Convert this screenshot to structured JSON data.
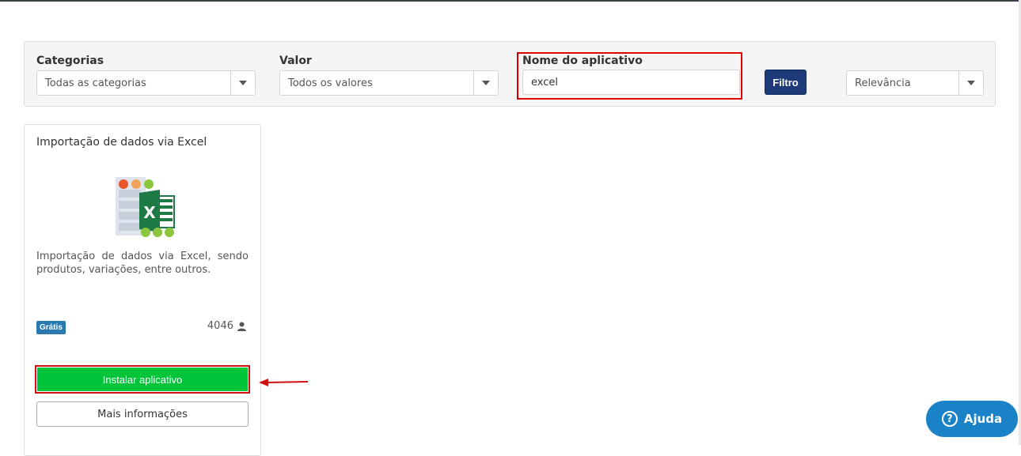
{
  "filters": {
    "categories": {
      "label": "Categorias",
      "value": "Todas as categorias"
    },
    "value": {
      "label": "Valor",
      "value": "Todos os valores"
    },
    "app_name": {
      "label": "Nome do aplicativo",
      "value": "excel"
    },
    "filter_button": "Filtro",
    "sort": {
      "value": "Relevância"
    }
  },
  "app_card": {
    "title": "Importação de dados via Excel",
    "icon": "excel-import-icon",
    "description": "Importação de dados via Excel, sendo produtos, variações, entre outros.",
    "badge": "Grátis",
    "installs": "4046",
    "install_button": "Instalar aplicativo",
    "more_button": "Mais informações"
  },
  "help": {
    "label": "Ajuda",
    "icon": "?"
  },
  "colors": {
    "highlight": "#e00000",
    "install_green": "#00c53a",
    "filter_blue": "#1f3a78",
    "help_blue": "#1a82c6",
    "badge_blue": "#2a7ab0"
  }
}
